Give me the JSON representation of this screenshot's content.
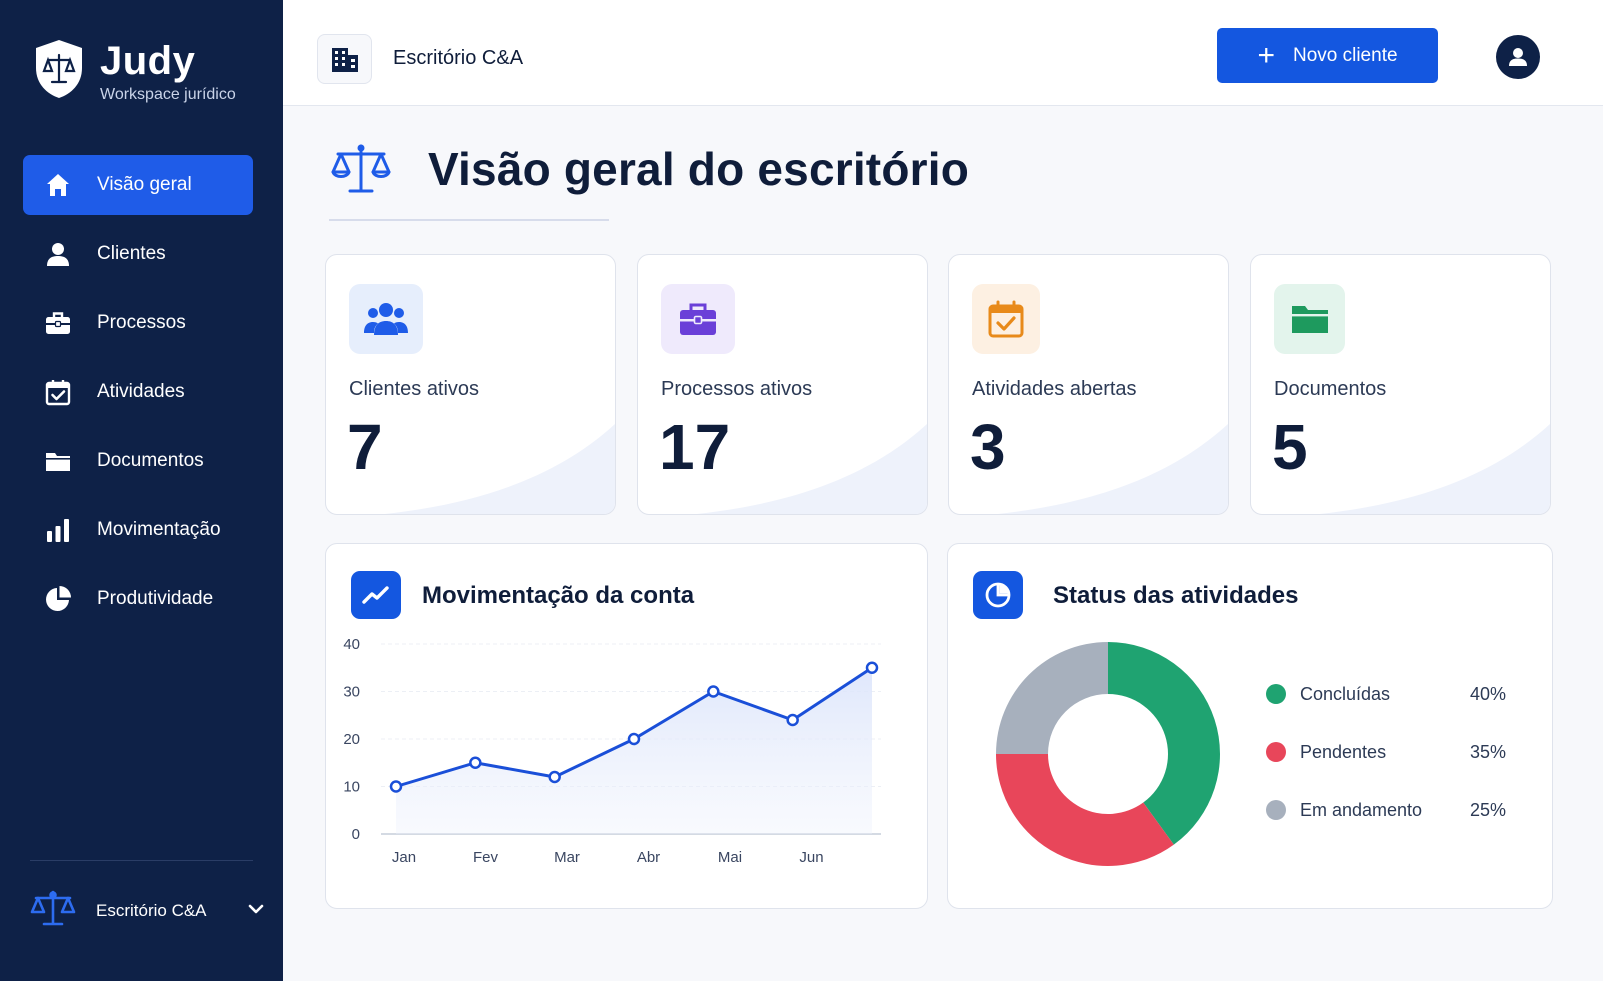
{
  "brand": {
    "name": "Judy",
    "subtitle": "Workspace jurídico"
  },
  "sidebar": {
    "items": [
      {
        "label": "Visão geral",
        "icon": "home-icon",
        "active": true
      },
      {
        "label": "Clientes",
        "icon": "user-icon"
      },
      {
        "label": "Processos",
        "icon": "briefcase-icon"
      },
      {
        "label": "Atividades",
        "icon": "calendar-check-icon"
      },
      {
        "label": "Documentos",
        "icon": "folder-icon"
      },
      {
        "label": "Movimentação",
        "icon": "bar-chart-icon"
      },
      {
        "label": "Produtividade",
        "icon": "pie-chart-icon"
      }
    ],
    "office": {
      "label": "Escritório C&A",
      "icon": "scales-icon"
    }
  },
  "header": {
    "office_name": "Escritório C&A",
    "new_client_label": "Novo cliente"
  },
  "page": {
    "title": "Visão geral do escritório"
  },
  "stats": [
    {
      "label": "Clientes ativos",
      "value": "7",
      "icon": "users-icon",
      "color": "#1f5ce8"
    },
    {
      "label": "Processos ativos",
      "value": "17",
      "icon": "briefcase-icon",
      "color": "#6a3fd8"
    },
    {
      "label": "Atividades abertas",
      "value": "3",
      "icon": "calendar-check-icon",
      "color": "#e88a1a"
    },
    {
      "label": "Documentos",
      "value": "5",
      "icon": "folder-icon",
      "color": "#1e9a5e"
    }
  ],
  "movement_panel": {
    "title": "Movimentação da conta"
  },
  "status_panel": {
    "title": "Status das atividades"
  },
  "chart_data": [
    {
      "type": "line",
      "title": "Movimentação da conta",
      "x": [
        "Jan",
        "Fev",
        "Mar",
        "Abr",
        "Mai",
        "Jun"
      ],
      "series": [
        {
          "values": [
            10,
            15,
            12,
            20,
            30,
            24,
            35
          ]
        }
      ],
      "ylim": [
        0,
        40
      ],
      "yticks": [
        0,
        10,
        20,
        30,
        40
      ],
      "grid": true,
      "color": "#1a4fd8"
    },
    {
      "type": "pie",
      "title": "Status das atividades",
      "slices": [
        {
          "label": "Concluídas",
          "value": 40,
          "display": "40%",
          "color": "#1fa371"
        },
        {
          "label": "Pendentes",
          "value": 35,
          "display": "35%",
          "color": "#e8465a"
        },
        {
          "label": "Em andamento",
          "value": 25,
          "display": "25%",
          "color": "#a7b0bd"
        }
      ]
    }
  ]
}
